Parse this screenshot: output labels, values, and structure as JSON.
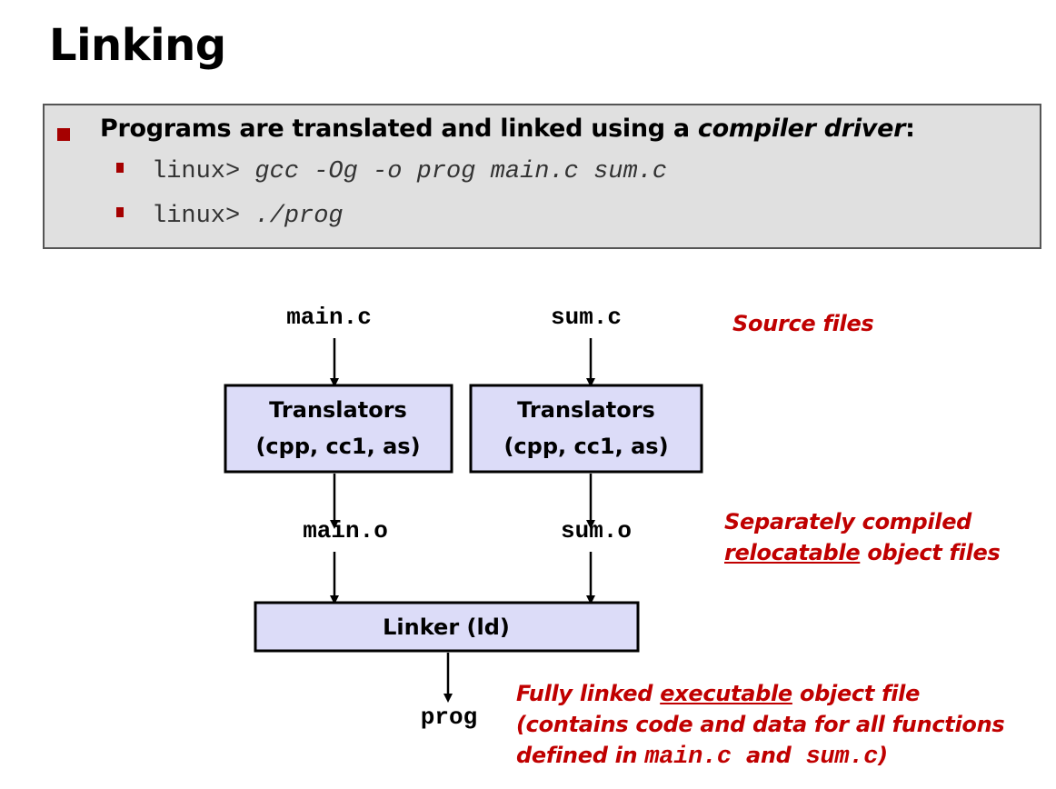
{
  "title": "Linking",
  "bullets": {
    "main_prefix": "Programs are translated and linked using a ",
    "main_emph": "compiler driver",
    "main_suffix": ":",
    "commands": [
      {
        "prompt": "linux> ",
        "command": "gcc -Og -o prog main.c sum.c"
      },
      {
        "prompt": "linux> ",
        "command": "./prog"
      }
    ]
  },
  "diagram": {
    "source_files": [
      "main.c",
      "sum.c"
    ],
    "translators": [
      {
        "line1": "Translators",
        "line2": "(cpp, cc1, as)"
      },
      {
        "line1": "Translators",
        "line2": "(cpp, cc1, as)"
      }
    ],
    "object_files": [
      "main.o",
      "sum.o"
    ],
    "linker": "Linker (ld)",
    "output": "prog"
  },
  "notes": {
    "source": "Source files",
    "object_line1": "Separately compiled",
    "object_underlined": "relocatable",
    "object_rest": " object files",
    "exec_prefix": "Fully linked ",
    "exec_underlined": "executable",
    "exec_rest": " object file",
    "exec_line2": "(contains code and data for all functions",
    "exec_line3_a": "defined in ",
    "exec_line3_file1": "main.c",
    "exec_line3_b": "  and  ",
    "exec_line3_file2": "sum.c",
    "exec_line3_c": ")"
  },
  "colors": {
    "accent_red": "#c00000",
    "box_fill": "#dcdcf8",
    "panel_fill": "#e0e0e0"
  }
}
